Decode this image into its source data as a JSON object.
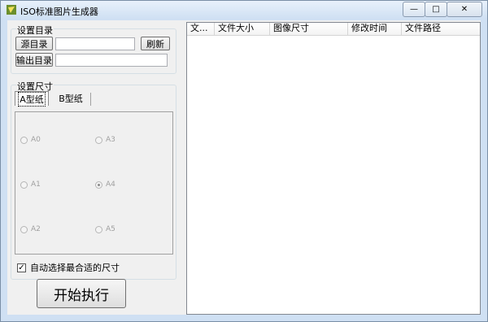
{
  "window": {
    "title": "ISO标准图片生成器",
    "controls": {
      "minimize": "—",
      "maximize": "□",
      "close": "✕"
    }
  },
  "directory_group": {
    "legend": "设置目录",
    "source_button": "源目录",
    "source_value": "",
    "refresh_button": "刷新",
    "output_button": "输出目录",
    "output_value": ""
  },
  "size_group": {
    "legend": "设置尺寸",
    "tabs": [
      {
        "label": "A型纸",
        "active": true
      },
      {
        "label": "B型纸",
        "active": false
      }
    ],
    "options": [
      {
        "label": "A0",
        "checked": false
      },
      {
        "label": "A3",
        "checked": false
      },
      {
        "label": "A1",
        "checked": false
      },
      {
        "label": "A4",
        "checked": true
      },
      {
        "label": "A2",
        "checked": false
      },
      {
        "label": "A5",
        "checked": false
      }
    ],
    "auto_fit_label": "自动选择最合适的尺寸",
    "auto_fit_checked": true
  },
  "start_button": "开始执行",
  "file_list": {
    "columns": [
      "文...",
      "文件大小",
      "图像尺寸",
      "修改时间",
      "文件路径"
    ],
    "rows": []
  }
}
